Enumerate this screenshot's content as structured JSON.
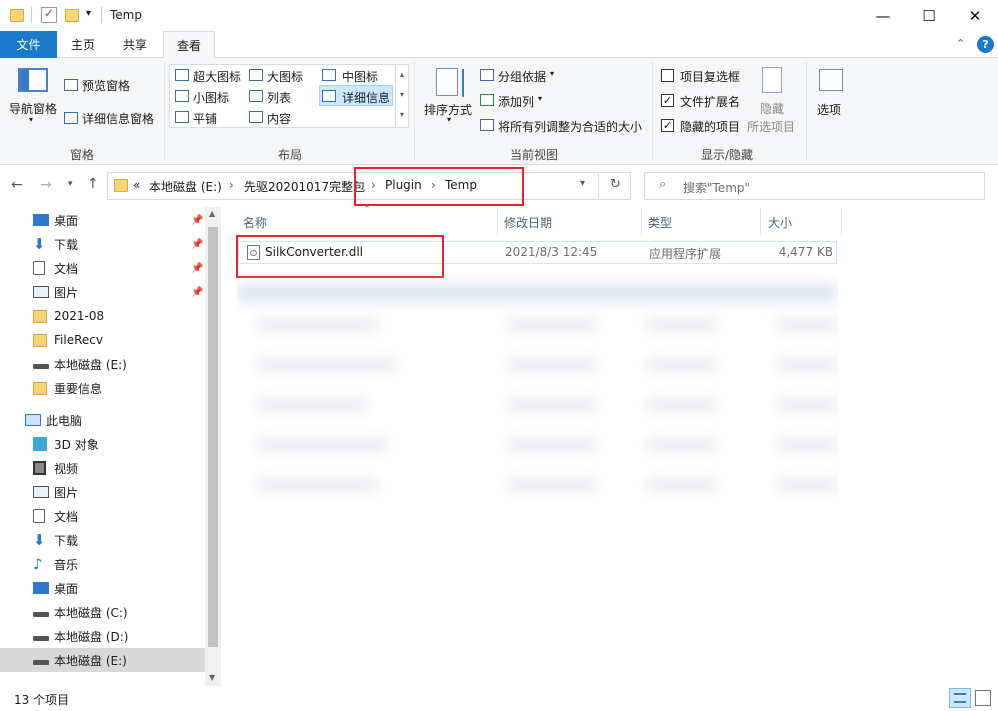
{
  "window": {
    "title": "Temp",
    "minimize_glyph": "—",
    "maximize_glyph": "☐",
    "close_glyph": "✕",
    "quick_access_dropdown": "▾"
  },
  "tabs": [
    "文件",
    "主页",
    "共享",
    "查看"
  ],
  "ribbon": {
    "pane_group": {
      "nav_pane": "导航窗格",
      "preview_pane": "预览窗格",
      "details_pane": "详细信息窗格",
      "label": "窗格"
    },
    "layout_group": {
      "items": [
        "超大图标",
        "大图标",
        "中图标",
        "小图标",
        "列表",
        "详细信息",
        "平铺",
        "内容"
      ],
      "label": "布局"
    },
    "current_view_group": {
      "sort_by": "排序方式",
      "group_by": "分组依据",
      "add_columns": "添加列",
      "size_columns": "将所有列调整为合适的大小",
      "label": "当前视图"
    },
    "show_hide_group": {
      "item_checkboxes": "项目复选框",
      "file_extensions": "文件扩展名",
      "hidden_items": "隐藏的项目",
      "hide_selected": "隐藏",
      "selected_items": "所选项目",
      "label": "显示/隐藏"
    },
    "options": "选项"
  },
  "address": {
    "overflow": "«",
    "crumbs": [
      "本地磁盘 (E:)",
      "先驱20201017完整包",
      "Plugin",
      "Temp"
    ],
    "search_placeholder": "搜索\"Temp\""
  },
  "nav_pane": {
    "quick_access": [
      "桌面",
      "下载",
      "文档",
      "图片",
      "2021-08",
      "FileRecv",
      "本地磁盘 (E:)",
      "重要信息"
    ],
    "this_pc": "此电脑",
    "pc_items": [
      "3D 对象",
      "视频",
      "图片",
      "文档",
      "下载",
      "音乐",
      "桌面",
      "本地磁盘 (C:)",
      "本地磁盘 (D:)",
      "本地磁盘 (E:)"
    ]
  },
  "file_list": {
    "columns": [
      "名称",
      "修改日期",
      "类型",
      "大小"
    ],
    "rows": [
      {
        "name": "SilkConverter.dll",
        "modified": "2021/8/3 12:45",
        "type": "应用程序扩展",
        "size": "4,477 KB"
      }
    ]
  },
  "status": {
    "item_count": "13 个项目"
  },
  "colors": {
    "accent": "#1979ca",
    "highlight_box": "#e0262b",
    "selection": "#cce8ff"
  }
}
